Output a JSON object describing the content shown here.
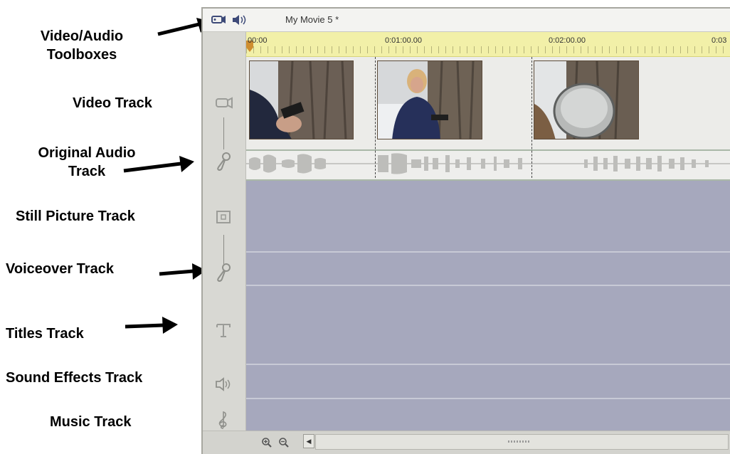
{
  "annotations": {
    "toolboxes": "Video/Audio\nToolboxes",
    "video_track": "Video Track",
    "original_audio_track": "Original Audio\nTrack",
    "still_picture_track": "Still Picture Track",
    "voiceover_track": "Voiceover Track",
    "titles_track": "Titles Track",
    "sound_effects_track": "Sound Effects Track",
    "music_track": "Music Track"
  },
  "window": {
    "title": "My Movie 5 *",
    "toolbar_icons": [
      "video-toolbox-icon",
      "audio-toolbox-icon"
    ]
  },
  "timeline": {
    "ruler_labels": [
      "00:00",
      "0:01:00.00",
      "0:02:00.00",
      "0:03"
    ],
    "clips": [
      {
        "name": "clip-tree-drill",
        "colors": [
          "#6f6157",
          "#2b3045"
        ]
      },
      {
        "name": "clip-woman-tapping",
        "colors": [
          "#7c6a58",
          "#2a3458"
        ]
      },
      {
        "name": "clip-sap-bucket",
        "colors": [
          "#6a5d4f",
          "#c9cbc8"
        ]
      }
    ]
  },
  "tracks": [
    "video-track",
    "original-audio-track",
    "still-picture-track",
    "voiceover-track",
    "titles-track",
    "sound-effects-track",
    "music-track"
  ],
  "track_icons": [
    "camcorder-icon",
    "microphone-icon",
    "still-picture-icon",
    "microphone-icon",
    "title-t-icon",
    "speaker-icon",
    "treble-clef-icon"
  ],
  "bottombar": {
    "zoom_in": "zoom-in-icon",
    "zoom_out": "zoom-out-icon"
  }
}
